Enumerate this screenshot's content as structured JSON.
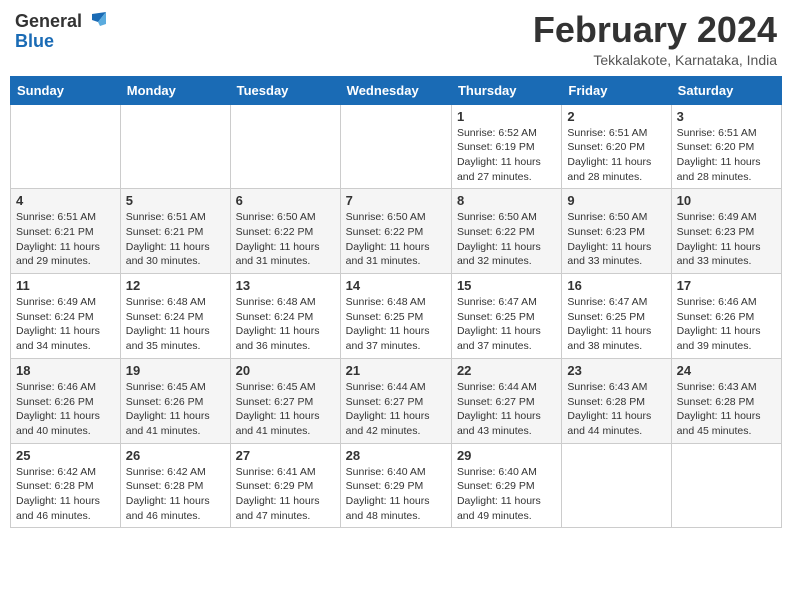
{
  "header": {
    "logo_general": "General",
    "logo_blue": "Blue",
    "title": "February 2024",
    "subtitle": "Tekkalakote, Karnataka, India"
  },
  "weekdays": [
    "Sunday",
    "Monday",
    "Tuesday",
    "Wednesday",
    "Thursday",
    "Friday",
    "Saturday"
  ],
  "weeks": [
    [
      {
        "day": "",
        "info": ""
      },
      {
        "day": "",
        "info": ""
      },
      {
        "day": "",
        "info": ""
      },
      {
        "day": "",
        "info": ""
      },
      {
        "day": "1",
        "info": "Sunrise: 6:52 AM\nSunset: 6:19 PM\nDaylight: 11 hours and 27 minutes."
      },
      {
        "day": "2",
        "info": "Sunrise: 6:51 AM\nSunset: 6:20 PM\nDaylight: 11 hours and 28 minutes."
      },
      {
        "day": "3",
        "info": "Sunrise: 6:51 AM\nSunset: 6:20 PM\nDaylight: 11 hours and 28 minutes."
      }
    ],
    [
      {
        "day": "4",
        "info": "Sunrise: 6:51 AM\nSunset: 6:21 PM\nDaylight: 11 hours and 29 minutes."
      },
      {
        "day": "5",
        "info": "Sunrise: 6:51 AM\nSunset: 6:21 PM\nDaylight: 11 hours and 30 minutes."
      },
      {
        "day": "6",
        "info": "Sunrise: 6:50 AM\nSunset: 6:22 PM\nDaylight: 11 hours and 31 minutes."
      },
      {
        "day": "7",
        "info": "Sunrise: 6:50 AM\nSunset: 6:22 PM\nDaylight: 11 hours and 31 minutes."
      },
      {
        "day": "8",
        "info": "Sunrise: 6:50 AM\nSunset: 6:22 PM\nDaylight: 11 hours and 32 minutes."
      },
      {
        "day": "9",
        "info": "Sunrise: 6:50 AM\nSunset: 6:23 PM\nDaylight: 11 hours and 33 minutes."
      },
      {
        "day": "10",
        "info": "Sunrise: 6:49 AM\nSunset: 6:23 PM\nDaylight: 11 hours and 33 minutes."
      }
    ],
    [
      {
        "day": "11",
        "info": "Sunrise: 6:49 AM\nSunset: 6:24 PM\nDaylight: 11 hours and 34 minutes."
      },
      {
        "day": "12",
        "info": "Sunrise: 6:48 AM\nSunset: 6:24 PM\nDaylight: 11 hours and 35 minutes."
      },
      {
        "day": "13",
        "info": "Sunrise: 6:48 AM\nSunset: 6:24 PM\nDaylight: 11 hours and 36 minutes."
      },
      {
        "day": "14",
        "info": "Sunrise: 6:48 AM\nSunset: 6:25 PM\nDaylight: 11 hours and 37 minutes."
      },
      {
        "day": "15",
        "info": "Sunrise: 6:47 AM\nSunset: 6:25 PM\nDaylight: 11 hours and 37 minutes."
      },
      {
        "day": "16",
        "info": "Sunrise: 6:47 AM\nSunset: 6:25 PM\nDaylight: 11 hours and 38 minutes."
      },
      {
        "day": "17",
        "info": "Sunrise: 6:46 AM\nSunset: 6:26 PM\nDaylight: 11 hours and 39 minutes."
      }
    ],
    [
      {
        "day": "18",
        "info": "Sunrise: 6:46 AM\nSunset: 6:26 PM\nDaylight: 11 hours and 40 minutes."
      },
      {
        "day": "19",
        "info": "Sunrise: 6:45 AM\nSunset: 6:26 PM\nDaylight: 11 hours and 41 minutes."
      },
      {
        "day": "20",
        "info": "Sunrise: 6:45 AM\nSunset: 6:27 PM\nDaylight: 11 hours and 41 minutes."
      },
      {
        "day": "21",
        "info": "Sunrise: 6:44 AM\nSunset: 6:27 PM\nDaylight: 11 hours and 42 minutes."
      },
      {
        "day": "22",
        "info": "Sunrise: 6:44 AM\nSunset: 6:27 PM\nDaylight: 11 hours and 43 minutes."
      },
      {
        "day": "23",
        "info": "Sunrise: 6:43 AM\nSunset: 6:28 PM\nDaylight: 11 hours and 44 minutes."
      },
      {
        "day": "24",
        "info": "Sunrise: 6:43 AM\nSunset: 6:28 PM\nDaylight: 11 hours and 45 minutes."
      }
    ],
    [
      {
        "day": "25",
        "info": "Sunrise: 6:42 AM\nSunset: 6:28 PM\nDaylight: 11 hours and 46 minutes."
      },
      {
        "day": "26",
        "info": "Sunrise: 6:42 AM\nSunset: 6:28 PM\nDaylight: 11 hours and 46 minutes."
      },
      {
        "day": "27",
        "info": "Sunrise: 6:41 AM\nSunset: 6:29 PM\nDaylight: 11 hours and 47 minutes."
      },
      {
        "day": "28",
        "info": "Sunrise: 6:40 AM\nSunset: 6:29 PM\nDaylight: 11 hours and 48 minutes."
      },
      {
        "day": "29",
        "info": "Sunrise: 6:40 AM\nSunset: 6:29 PM\nDaylight: 11 hours and 49 minutes."
      },
      {
        "day": "",
        "info": ""
      },
      {
        "day": "",
        "info": ""
      }
    ]
  ]
}
